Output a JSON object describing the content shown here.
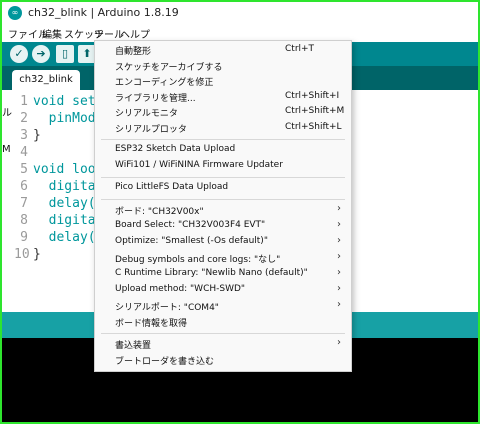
{
  "window": {
    "title": "ch32_blink | Arduino 1.8.19",
    "icon": "arduino-logo-icon"
  },
  "menubar": {
    "items": [
      "ファイル",
      "編集",
      "スケッチ",
      "ツール",
      "ヘルプ"
    ]
  },
  "toolbar": {
    "buttons": [
      "verify-icon",
      "upload-icon",
      "new-icon",
      "open-icon"
    ]
  },
  "tabs": [
    {
      "label": "ch32_blink"
    }
  ],
  "editor": {
    "lines": [
      {
        "num": "1",
        "text": "void set"
      },
      {
        "num": "2",
        "text": "  pinMod"
      },
      {
        "num": "3",
        "text": "}"
      },
      {
        "num": "4",
        "text": ""
      },
      {
        "num": "5",
        "text": "void loo"
      },
      {
        "num": "6",
        "text": "  digita"
      },
      {
        "num": "7",
        "text": "  delay("
      },
      {
        "num": "8",
        "text": "  digita"
      },
      {
        "num": "9",
        "text": "  delay("
      },
      {
        "num": "10",
        "text": "}"
      }
    ],
    "side_glyphs": [
      "ル",
      "M"
    ]
  },
  "tools_menu": {
    "items": [
      {
        "label": "自動整形",
        "shortcut": "Ctrl+T"
      },
      {
        "label": "スケッチをアーカイブする",
        "shortcut": ""
      },
      {
        "label": "エンコーディングを修正",
        "shortcut": ""
      },
      {
        "label": "ライブラリを管理...",
        "shortcut": "Ctrl+Shift+I"
      },
      {
        "label": "シリアルモニタ",
        "shortcut": "Ctrl+Shift+M"
      },
      {
        "label": "シリアルプロッタ",
        "shortcut": "Ctrl+Shift+L"
      },
      {
        "label": "ESP32 Sketch Data Upload",
        "shortcut": ""
      },
      {
        "label": "WiFi101 / WiFiNINA Firmware Updater",
        "shortcut": ""
      },
      {
        "label": "Pico LittleFS Data Upload",
        "shortcut": ""
      },
      {
        "label": "ボード: \"CH32V00x\"",
        "shortcut": "",
        "submenu": true
      },
      {
        "label": "Board Select: \"CH32V003F4 EVT\"",
        "shortcut": "",
        "submenu": true
      },
      {
        "label": "Optimize: \"Smallest (-Os default)\"",
        "shortcut": "",
        "submenu": true
      },
      {
        "label": "Debug symbols and core logs: \"なし\"",
        "shortcut": "",
        "submenu": true
      },
      {
        "label": "C Runtime Library: \"Newlib Nano (default)\"",
        "shortcut": "",
        "submenu": true
      },
      {
        "label": "Upload method: \"WCH-SWD\"",
        "shortcut": "",
        "submenu": true
      },
      {
        "label": "シリアルポート: \"COM4\"",
        "shortcut": "",
        "submenu": true
      },
      {
        "label": "ボード情報を取得",
        "shortcut": ""
      },
      {
        "label": "書込装置",
        "shortcut": "",
        "submenu": true
      },
      {
        "label": "ブートローダを書き込む",
        "shortcut": ""
      }
    ],
    "submenu_arrow": "›"
  },
  "colors": {
    "toolbar": "#00878f",
    "tabs_bg": "#006468",
    "status": "#17a1a5",
    "console": "#000000",
    "code": "#00979c",
    "frame": "#2ee52e"
  }
}
